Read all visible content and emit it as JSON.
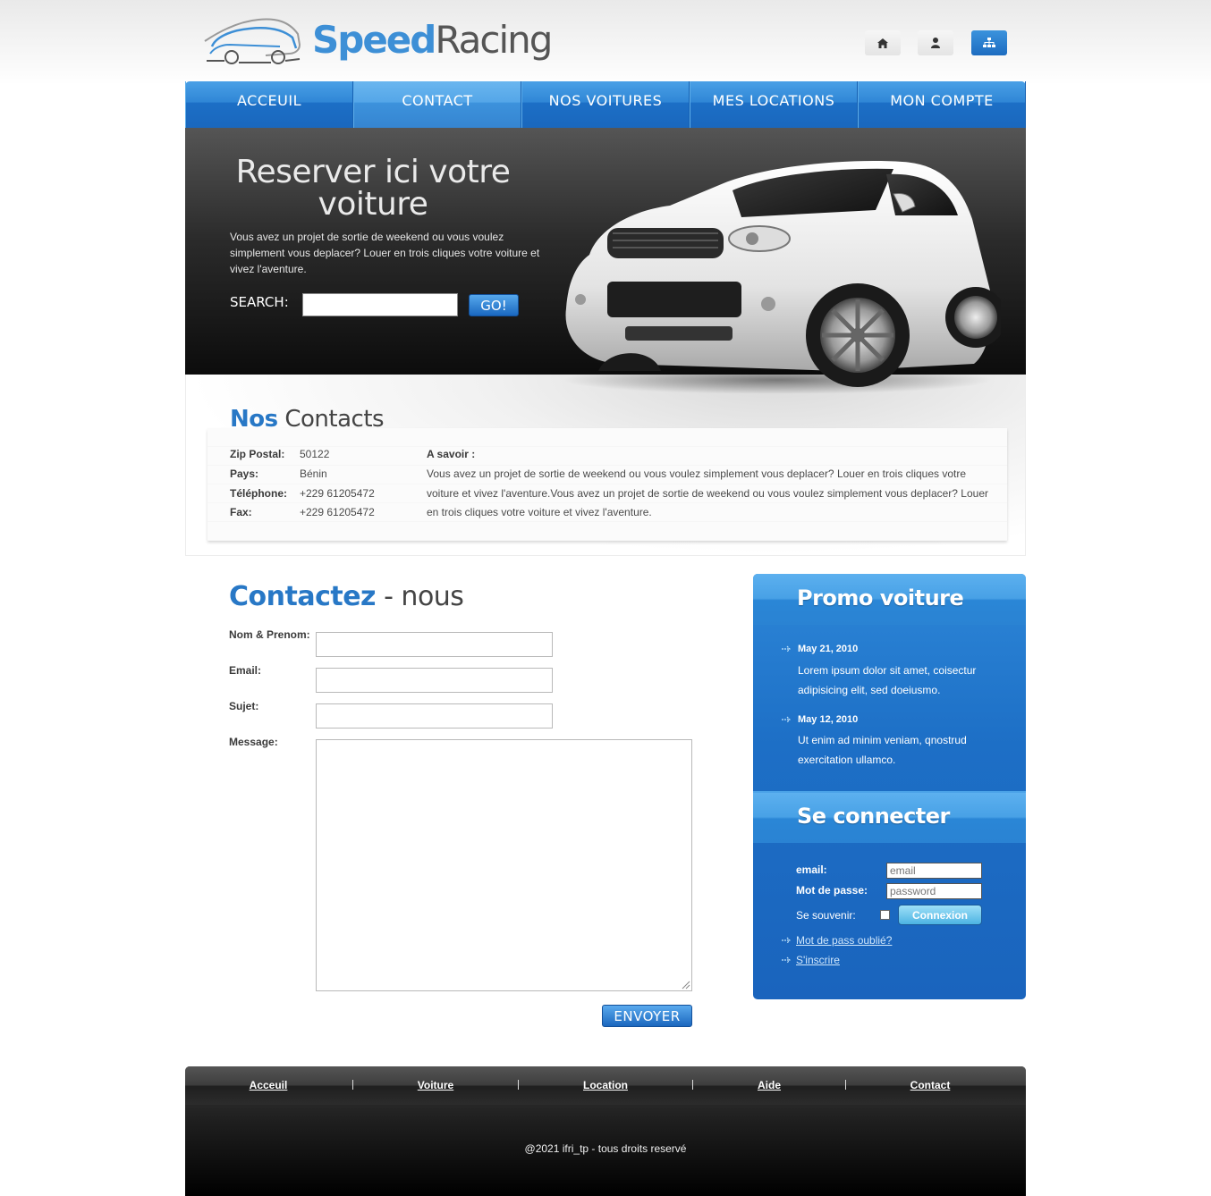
{
  "header": {
    "logo_speed": "Speed",
    "logo_racing": "Racing",
    "icons": [
      "home-icon",
      "user-icon",
      "sitemap-icon"
    ]
  },
  "nav": [
    "ACCEUIL",
    "CONTACT",
    "NOS VOITURES",
    "MES LOCATIONS",
    "MON COMPTE"
  ],
  "hero": {
    "title": "Reserver ici votre voiture",
    "text": "Vous avez un projet de sortie de weekend ou vous voulez simplement vous deplacer? Louer en trois cliques votre voiture et vivez l'aventure.",
    "search_label": "SEARCH:",
    "go_label": "GO!"
  },
  "contacts": {
    "title_hl": "Nos",
    "title_rest": "Contacts",
    "rows": [
      {
        "label": "Zip Postal:",
        "value": "50122"
      },
      {
        "label": "Pays:",
        "value": "Bénin"
      },
      {
        "label": "Téléphone:",
        "value": "+229 61205472"
      },
      {
        "label": "Fax:",
        "value": "+229 61205472"
      }
    ],
    "asavoir_title": "A savoir :",
    "asavoir_text": "Vous avez un projet de sortie de weekend ou vous voulez simplement vous deplacer? Louer en trois cliques votre voiture et vivez l'aventure.Vous avez un projet de sortie de weekend ou vous voulez simplement vous deplacer? Louer en trois cliques votre voiture et vivez l'aventure."
  },
  "form": {
    "title_hl": "Contactez",
    "title_rest": "- nous",
    "name_label": "Nom & Prenom:",
    "email_label": "Email:",
    "subject_label": "Sujet:",
    "message_label": "Message:",
    "send_label": "ENVOYER"
  },
  "promo": {
    "title": "Promo voiture",
    "items": [
      {
        "date": "May 21, 2010",
        "text": "Lorem ipsum dolor sit amet, coisectur adipisicing elit, sed doeiusmo."
      },
      {
        "date": "May 12, 2010",
        "text": "Ut enim ad minim veniam, qnostrud exercitation ullamco."
      }
    ]
  },
  "login": {
    "title": "Se connecter",
    "email_label": "email:",
    "email_placeholder": "email",
    "password_label": "Mot de passe:",
    "password_placeholder": "password",
    "remember_label": "Se souvenir:",
    "button_label": "Connexion",
    "forgot_link": "Mot de pass oublié?",
    "register_link": "S'inscrire"
  },
  "footer": {
    "links": [
      "Acceuil",
      "Voiture",
      "Location",
      "Aide",
      "Contact"
    ],
    "copyright": "@2021 ifri_tp - tous droits reservé"
  },
  "colors": {
    "accent": "#2878c6",
    "nav_blue": "#2f86d6",
    "sidebar_blue": "#1d6fc6"
  }
}
